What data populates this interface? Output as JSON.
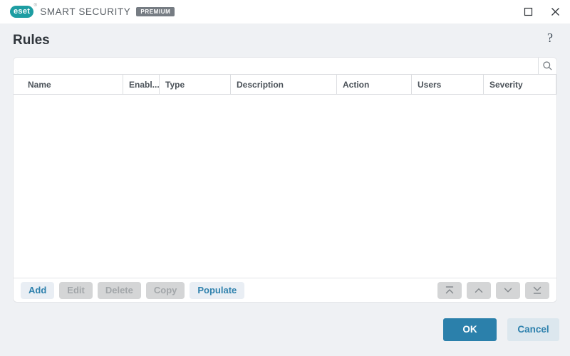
{
  "titlebar": {
    "logo_text": "eset",
    "registered_mark": "®",
    "product_name": "SMART SECURITY",
    "badge_label": "PREMIUM"
  },
  "page": {
    "title": "Rules",
    "help_label": "?"
  },
  "search": {
    "value": "",
    "placeholder": ""
  },
  "rules_table": {
    "columns": [
      {
        "label": "Name"
      },
      {
        "label": "Enabl..."
      },
      {
        "label": "Type"
      },
      {
        "label": "Description"
      },
      {
        "label": "Action"
      },
      {
        "label": "Users"
      },
      {
        "label": "Severity"
      }
    ],
    "rows": []
  },
  "toolbar": {
    "buttons": [
      {
        "label": "Add",
        "enabled": true
      },
      {
        "label": "Edit",
        "enabled": false
      },
      {
        "label": "Delete",
        "enabled": false
      },
      {
        "label": "Copy",
        "enabled": false
      },
      {
        "label": "Populate",
        "enabled": true
      }
    ],
    "move_buttons": [
      {
        "icon": "move-top-icon",
        "enabled": false
      },
      {
        "icon": "move-up-icon",
        "enabled": false
      },
      {
        "icon": "move-down-icon",
        "enabled": false
      },
      {
        "icon": "move-bottom-icon",
        "enabled": false
      }
    ]
  },
  "footer": {
    "ok_label": "OK",
    "cancel_label": "Cancel"
  },
  "colors": {
    "brand_teal": "#1d9da2",
    "accent_blue": "#2b80ab",
    "light_button_bg": "#e9eef4",
    "disabled_bg": "#d4d5d6",
    "page_bg": "#eff1f4",
    "badge_bg": "#767c83"
  }
}
